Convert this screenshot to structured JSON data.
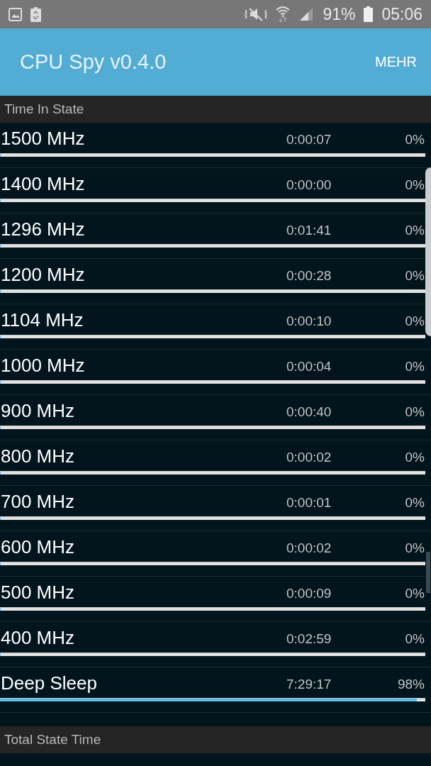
{
  "status_bar": {
    "battery": "91%",
    "time": "05:06"
  },
  "app_bar": {
    "title": "CPU Spy v0.4.0",
    "menu": "MEHR"
  },
  "time_in_state": {
    "title": "Time In State",
    "states": [
      {
        "name": "1500 MHz",
        "time": "0:00:07",
        "percent": "0%",
        "level": 0
      },
      {
        "name": "1400 MHz",
        "time": "0:00:00",
        "percent": "0%",
        "level": 0
      },
      {
        "name": "1296 MHz",
        "time": "0:01:41",
        "percent": "0%",
        "level": 0
      },
      {
        "name": "1200 MHz",
        "time": "0:00:28",
        "percent": "0%",
        "level": 0
      },
      {
        "name": "1104 MHz",
        "time": "0:00:10",
        "percent": "0%",
        "level": 0
      },
      {
        "name": "1000 MHz",
        "time": "0:00:04",
        "percent": "0%",
        "level": 0
      },
      {
        "name": "900 MHz",
        "time": "0:00:40",
        "percent": "0%",
        "level": 0
      },
      {
        "name": "800 MHz",
        "time": "0:00:02",
        "percent": "0%",
        "level": 0
      },
      {
        "name": "700 MHz",
        "time": "0:00:01",
        "percent": "0%",
        "level": 0
      },
      {
        "name": "600 MHz",
        "time": "0:00:02",
        "percent": "0%",
        "level": 0
      },
      {
        "name": "500 MHz",
        "time": "0:00:09",
        "percent": "0%",
        "level": 0
      },
      {
        "name": "400 MHz",
        "time": "0:02:59",
        "percent": "0%",
        "level": 0
      },
      {
        "name": "Deep Sleep",
        "time": "7:29:17",
        "percent": "98%",
        "level": 0.98
      }
    ]
  },
  "total_state_time": {
    "title": "Total State Time"
  }
}
